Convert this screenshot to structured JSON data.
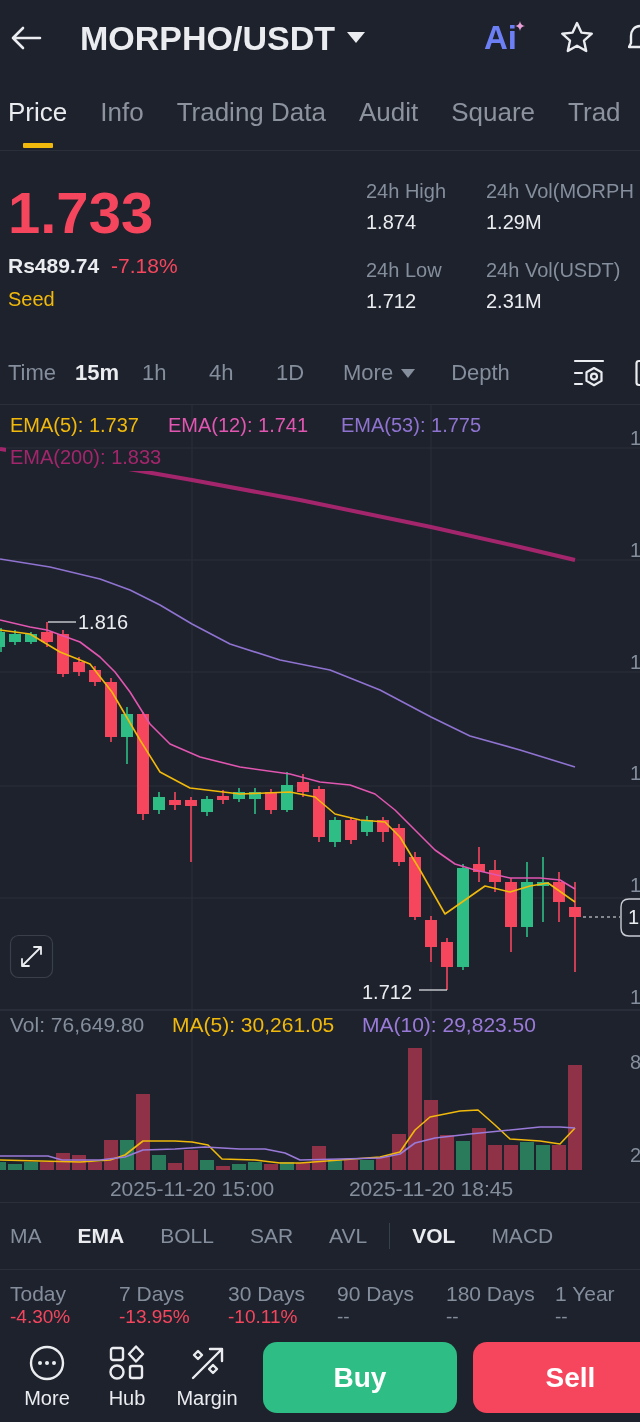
{
  "header": {
    "title": "MORPHO/USDT",
    "ai_label": "Ai"
  },
  "tabs": [
    {
      "label": "Price",
      "selected": true
    },
    {
      "label": "Info",
      "selected": false
    },
    {
      "label": "Trading Data",
      "selected": false
    },
    {
      "label": "Audit",
      "selected": false
    },
    {
      "label": "Square",
      "selected": false
    },
    {
      "label": "Trad",
      "selected": false
    }
  ],
  "ticker": {
    "price": "1.733",
    "fiat_price": "Rs489.74",
    "change": "-7.18%",
    "tag": "Seed",
    "stats": [
      {
        "label": "24h High",
        "value": "1.874"
      },
      {
        "label": "24h Vol(MORPH",
        "value": "1.29M"
      },
      {
        "label": "24h Low",
        "value": "1.712"
      },
      {
        "label": "24h Vol(USDT)",
        "value": "2.31M"
      }
    ]
  },
  "intervals": [
    {
      "label": "Time",
      "kind": "option",
      "selected": false
    },
    {
      "label": "15m",
      "kind": "option",
      "selected": true
    },
    {
      "label": "1h",
      "kind": "option",
      "selected": false
    },
    {
      "label": "4h",
      "kind": "option",
      "selected": false
    },
    {
      "label": "1D",
      "kind": "option",
      "selected": false
    },
    {
      "label": "More",
      "kind": "menu",
      "selected": false
    },
    {
      "label": "Depth",
      "kind": "option",
      "selected": false
    }
  ],
  "chart": {
    "indicators": [
      {
        "label": "EMA(5): 1.737",
        "color": "#f0b90b"
      },
      {
        "label": "EMA(12): 1.741",
        "color": "#e056b0"
      },
      {
        "label": "EMA(53): 1.775",
        "color": "#8f73d0"
      },
      {
        "label": "EMA(200): 1.833",
        "color": "#a3266c"
      }
    ],
    "y_axis_labels": [
      "1",
      "1",
      "1",
      "1",
      "1",
      "1"
    ],
    "high_label": "1.816",
    "low_label": "1.712",
    "price_tag": "1",
    "volume_legend": [
      {
        "label": "Vol: 76,649.80",
        "color": "#848e9c"
      },
      {
        "label": "MA(5): 30,261.05",
        "color": "#f0b90b"
      },
      {
        "label": "MA(10): 29,823.50",
        "color": "#9a7ad8"
      }
    ],
    "volume_axis_labels": [
      "8",
      "2"
    ],
    "time_labels": [
      "2025-11-20 15:00",
      "2025-11-20 18:45"
    ]
  },
  "main_indicators": [
    {
      "label": "MA",
      "selected": false
    },
    {
      "label": "EMA",
      "selected": true
    },
    {
      "label": "BOLL",
      "selected": false
    },
    {
      "label": "SAR",
      "selected": false
    },
    {
      "label": "AVL",
      "selected": false
    }
  ],
  "sub_indicators": [
    {
      "label": "VOL",
      "selected": true
    },
    {
      "label": "MACD",
      "selected": false
    }
  ],
  "performance": [
    {
      "period": "Today",
      "change": "-4.30%",
      "color": "#f6465d"
    },
    {
      "period": "7 Days",
      "change": "-13.95%",
      "color": "#f6465d"
    },
    {
      "period": "30 Days",
      "change": "-10.11%",
      "color": "#f6465d"
    },
    {
      "period": "90 Days",
      "change": "--",
      "color": "#848e9c"
    },
    {
      "period": "180 Days",
      "change": "--",
      "color": "#848e9c"
    },
    {
      "period": "1 Year",
      "change": "--",
      "color": "#848e9c"
    }
  ],
  "bottom_nav": [
    {
      "label": "More",
      "kind": "more"
    },
    {
      "label": "Hub",
      "kind": "hub"
    },
    {
      "label": "Margin",
      "kind": "margin"
    }
  ],
  "actions": [
    {
      "label": "Buy",
      "kind": "buy"
    },
    {
      "label": "Sell",
      "kind": "sell"
    }
  ]
}
